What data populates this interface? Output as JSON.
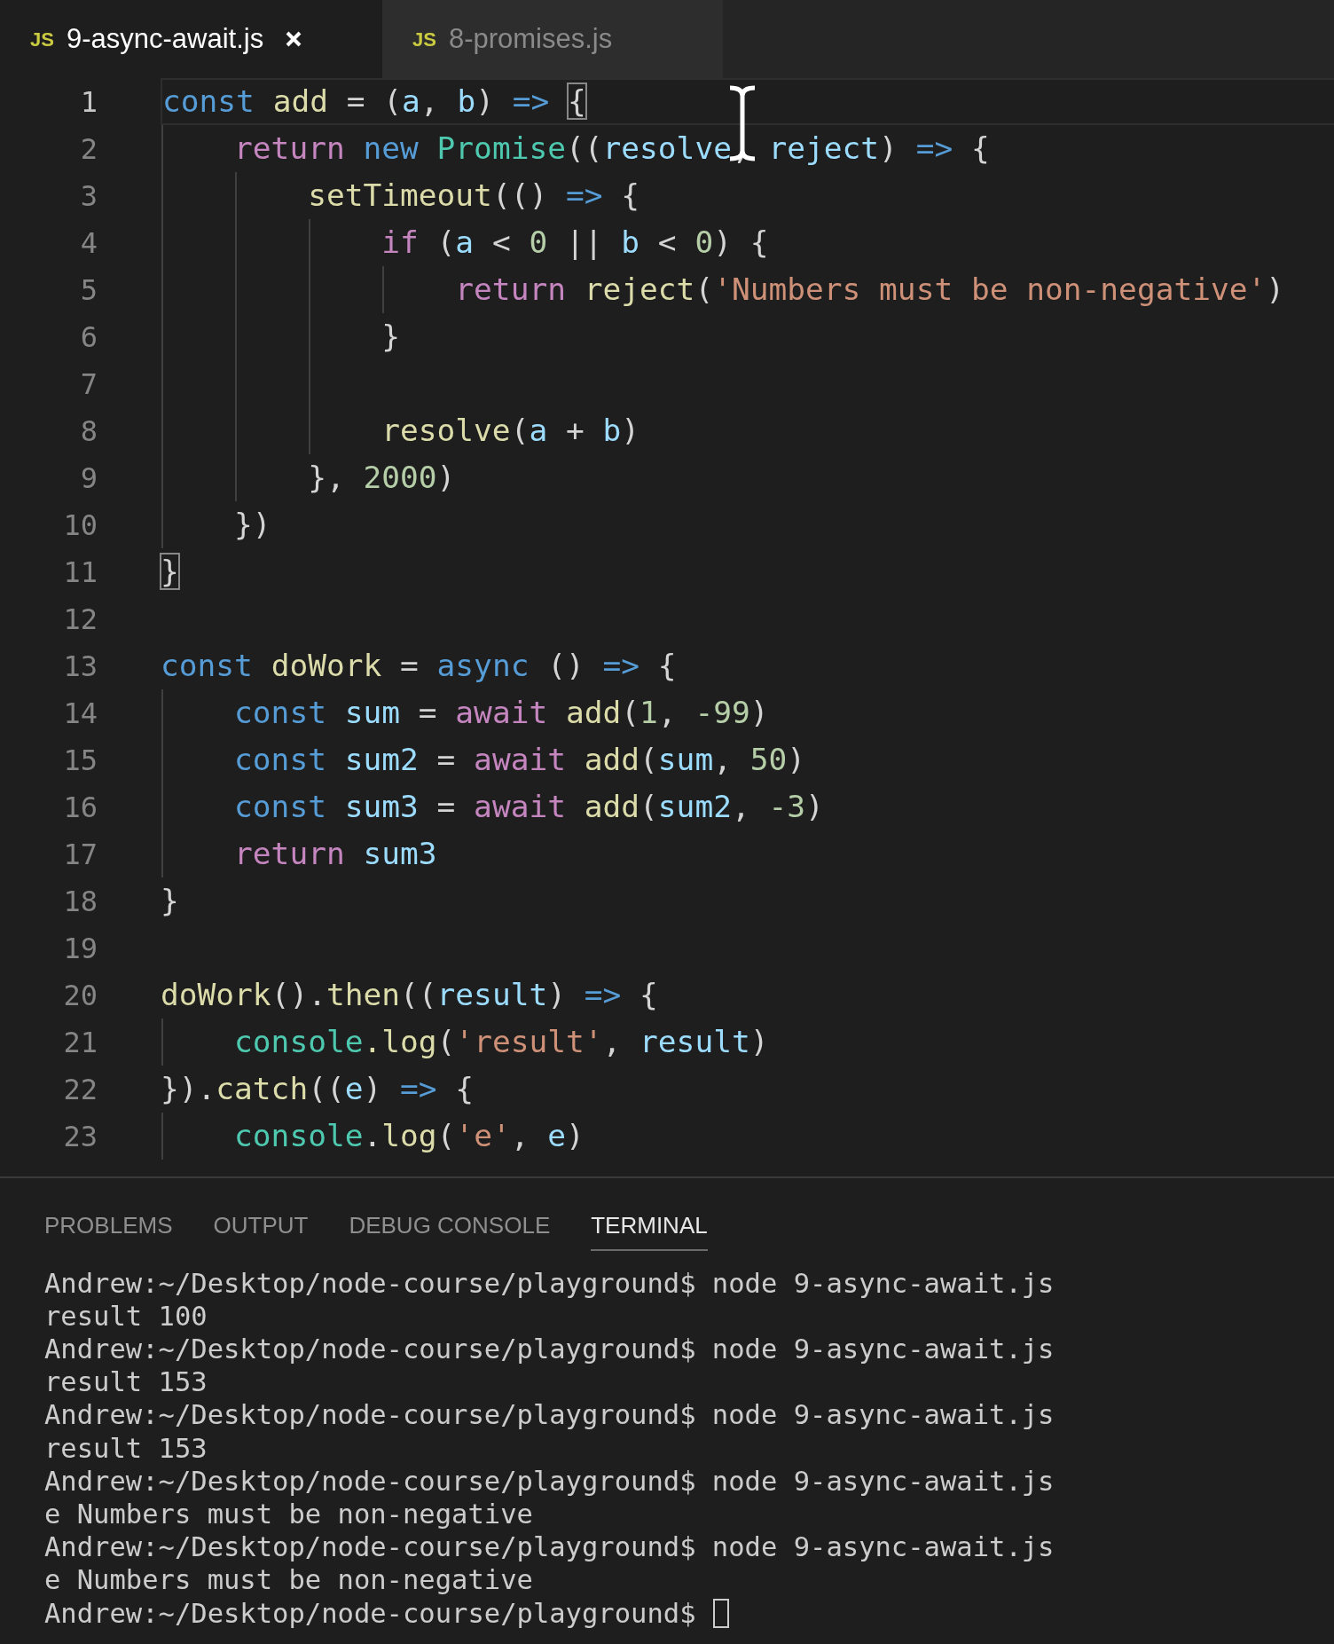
{
  "tabs": [
    {
      "icon_text": "JS",
      "label": "9-async-await.js",
      "selected": true,
      "closable": true
    },
    {
      "icon_text": "JS",
      "label": "8-promises.js",
      "selected": false,
      "closable": false
    }
  ],
  "editor": {
    "lines": [
      {
        "number": "1",
        "active": true,
        "tokens": [
          {
            "kind": "kw",
            "text": "const"
          },
          {
            "kind": "fn",
            "text": " add"
          },
          {
            "kind": "p",
            "text": " = ("
          },
          {
            "kind": "var",
            "text": "a"
          },
          {
            "kind": "p",
            "text": ", "
          },
          {
            "kind": "var",
            "text": "b"
          },
          {
            "kind": "p",
            "text": ") "
          },
          {
            "kind": "kw",
            "text": "=> "
          },
          {
            "kind": "match",
            "text": "{"
          }
        ]
      },
      {
        "number": "2",
        "active": false,
        "tokens": [
          {
            "kind": "ctl",
            "text": "    return"
          },
          {
            "kind": "kw",
            "text": " new"
          },
          {
            "kind": "cls",
            "text": " Promise"
          },
          {
            "kind": "p",
            "text": "(("
          },
          {
            "kind": "var",
            "text": "resolve"
          },
          {
            "kind": "p",
            "text": ", "
          },
          {
            "kind": "var",
            "text": "reject"
          },
          {
            "kind": "p",
            "text": ") "
          },
          {
            "kind": "kw",
            "text": "=>"
          },
          {
            "kind": "p",
            "text": " {"
          }
        ]
      },
      {
        "number": "3",
        "active": false,
        "tokens": [
          {
            "kind": "fn",
            "text": "        setTimeout"
          },
          {
            "kind": "p",
            "text": "(() "
          },
          {
            "kind": "kw",
            "text": "=>"
          },
          {
            "kind": "p",
            "text": " {"
          }
        ]
      },
      {
        "number": "4",
        "active": false,
        "tokens": [
          {
            "kind": "ctl",
            "text": "            if"
          },
          {
            "kind": "p",
            "text": " ("
          },
          {
            "kind": "var",
            "text": "a"
          },
          {
            "kind": "p",
            "text": " < "
          },
          {
            "kind": "num",
            "text": "0"
          },
          {
            "kind": "p",
            "text": " || "
          },
          {
            "kind": "var",
            "text": "b"
          },
          {
            "kind": "p",
            "text": " < "
          },
          {
            "kind": "num",
            "text": "0"
          },
          {
            "kind": "p",
            "text": ") {"
          }
        ]
      },
      {
        "number": "5",
        "active": false,
        "tokens": [
          {
            "kind": "ctl",
            "text": "                return"
          },
          {
            "kind": "fn",
            "text": " reject"
          },
          {
            "kind": "p",
            "text": "("
          },
          {
            "kind": "str",
            "text": "'Numbers must be non-negative'"
          },
          {
            "kind": "p",
            "text": ")"
          }
        ]
      },
      {
        "number": "6",
        "active": false,
        "tokens": [
          {
            "kind": "p",
            "text": "            }"
          }
        ]
      },
      {
        "number": "7",
        "active": false
      },
      {
        "number": "8",
        "active": false,
        "tokens": [
          {
            "kind": "fn",
            "text": "            resolve"
          },
          {
            "kind": "p",
            "text": "("
          },
          {
            "kind": "var",
            "text": "a"
          },
          {
            "kind": "p",
            "text": " + "
          },
          {
            "kind": "var",
            "text": "b"
          },
          {
            "kind": "p",
            "text": ")"
          }
        ]
      },
      {
        "number": "9",
        "active": false,
        "tokens": [
          {
            "kind": "p",
            "text": "        }, "
          },
          {
            "kind": "num",
            "text": "2000"
          },
          {
            "kind": "p",
            "text": ")"
          }
        ]
      },
      {
        "number": "10",
        "active": false,
        "tokens": [
          {
            "kind": "p",
            "text": "    })"
          }
        ]
      },
      {
        "number": "11",
        "active": false,
        "tokens": [
          {
            "kind": "match",
            "text": "}"
          }
        ]
      },
      {
        "number": "12",
        "active": false
      },
      {
        "number": "13",
        "active": false,
        "tokens": [
          {
            "kind": "kw",
            "text": "const"
          },
          {
            "kind": "fn",
            "text": " doWork"
          },
          {
            "kind": "p",
            "text": " = "
          },
          {
            "kind": "kw",
            "text": "async"
          },
          {
            "kind": "p",
            "text": " () "
          },
          {
            "kind": "kw",
            "text": "=>"
          },
          {
            "kind": "p",
            "text": " {"
          }
        ]
      },
      {
        "number": "14",
        "active": false,
        "tokens": [
          {
            "kind": "kw",
            "text": "    const"
          },
          {
            "kind": "var",
            "text": " sum"
          },
          {
            "kind": "p",
            "text": " = "
          },
          {
            "kind": "ctl",
            "text": "await"
          },
          {
            "kind": "fn",
            "text": " add"
          },
          {
            "kind": "p",
            "text": "("
          },
          {
            "kind": "num",
            "text": "1"
          },
          {
            "kind": "p",
            "text": ", "
          },
          {
            "kind": "num",
            "text": "-99"
          },
          {
            "kind": "p",
            "text": ")"
          }
        ]
      },
      {
        "number": "15",
        "active": false,
        "tokens": [
          {
            "kind": "kw",
            "text": "    const"
          },
          {
            "kind": "var",
            "text": " sum2"
          },
          {
            "kind": "p",
            "text": " = "
          },
          {
            "kind": "ctl",
            "text": "await"
          },
          {
            "kind": "fn",
            "text": " add"
          },
          {
            "kind": "p",
            "text": "("
          },
          {
            "kind": "var",
            "text": "sum"
          },
          {
            "kind": "p",
            "text": ", "
          },
          {
            "kind": "num",
            "text": "50"
          },
          {
            "kind": "p",
            "text": ")"
          }
        ]
      },
      {
        "number": "16",
        "active": false,
        "tokens": [
          {
            "kind": "kw",
            "text": "    const"
          },
          {
            "kind": "var",
            "text": " sum3"
          },
          {
            "kind": "p",
            "text": " = "
          },
          {
            "kind": "ctl",
            "text": "await"
          },
          {
            "kind": "fn",
            "text": " add"
          },
          {
            "kind": "p",
            "text": "("
          },
          {
            "kind": "var",
            "text": "sum2"
          },
          {
            "kind": "p",
            "text": ", "
          },
          {
            "kind": "num",
            "text": "-3"
          },
          {
            "kind": "p",
            "text": ")"
          }
        ]
      },
      {
        "number": "17",
        "active": false,
        "tokens": [
          {
            "kind": "ctl",
            "text": "    return"
          },
          {
            "kind": "var",
            "text": " sum3"
          }
        ]
      },
      {
        "number": "18",
        "active": false,
        "tokens": [
          {
            "kind": "p",
            "text": "}"
          }
        ]
      },
      {
        "number": "19",
        "active": false
      },
      {
        "number": "20",
        "active": false,
        "tokens": [
          {
            "kind": "fn",
            "text": "doWork"
          },
          {
            "kind": "p",
            "text": "()."
          },
          {
            "kind": "fn",
            "text": "then"
          },
          {
            "kind": "p",
            "text": "(("
          },
          {
            "kind": "var",
            "text": "result"
          },
          {
            "kind": "p",
            "text": ") "
          },
          {
            "kind": "kw",
            "text": "=>"
          },
          {
            "kind": "p",
            "text": " {"
          }
        ]
      },
      {
        "number": "21",
        "active": false,
        "tokens": [
          {
            "kind": "cls",
            "text": "    console"
          },
          {
            "kind": "fn",
            "text": ".log"
          },
          {
            "kind": "p",
            "text": "("
          },
          {
            "kind": "str",
            "text": "'result'"
          },
          {
            "kind": "p",
            "text": ", "
          },
          {
            "kind": "var",
            "text": "result"
          },
          {
            "kind": "p",
            "text": ")"
          }
        ]
      },
      {
        "number": "22",
        "active": false,
        "tokens": [
          {
            "kind": "p",
            "text": "})."
          },
          {
            "kind": "fn",
            "text": "catch"
          },
          {
            "kind": "p",
            "text": "(("
          },
          {
            "kind": "var",
            "text": "e"
          },
          {
            "kind": "p",
            "text": ") "
          },
          {
            "kind": "kw",
            "text": "=>"
          },
          {
            "kind": "p",
            "text": " {"
          }
        ]
      },
      {
        "number": "23",
        "active": false,
        "tokens": [
          {
            "kind": "cls",
            "text": "    console"
          },
          {
            "kind": "p",
            "text": "."
          },
          {
            "kind": "fn",
            "text": "log"
          },
          {
            "kind": "p",
            "text": "("
          },
          {
            "kind": "str",
            "text": "'e'"
          },
          {
            "kind": "p",
            "text": ", "
          },
          {
            "kind": "var",
            "text": "e"
          },
          {
            "kind": "p",
            "text": ")"
          }
        ]
      }
    ]
  },
  "panel": {
    "tabs": [
      {
        "label": "PROBLEMS",
        "selected": false
      },
      {
        "label": "OUTPUT",
        "selected": false
      },
      {
        "label": "DEBUG CONSOLE",
        "selected": false
      },
      {
        "label": "TERMINAL",
        "selected": true
      }
    ],
    "terminal": {
      "lines": [
        "Andrew:~/Desktop/node-course/playground$ node 9-async-await.js",
        "result 100",
        "Andrew:~/Desktop/node-course/playground$ node 9-async-await.js",
        "result 153",
        "Andrew:~/Desktop/node-course/playground$ node 9-async-await.js",
        "result 153",
        "Andrew:~/Desktop/node-course/playground$ node 9-async-await.js",
        "e Numbers must be non-negative",
        "Andrew:~/Desktop/node-course/playground$ node 9-async-await.js",
        "e Numbers must be non-negative",
        "Andrew:~/Desktop/node-course/playground$"
      ],
      "cursor_visible": true
    }
  }
}
